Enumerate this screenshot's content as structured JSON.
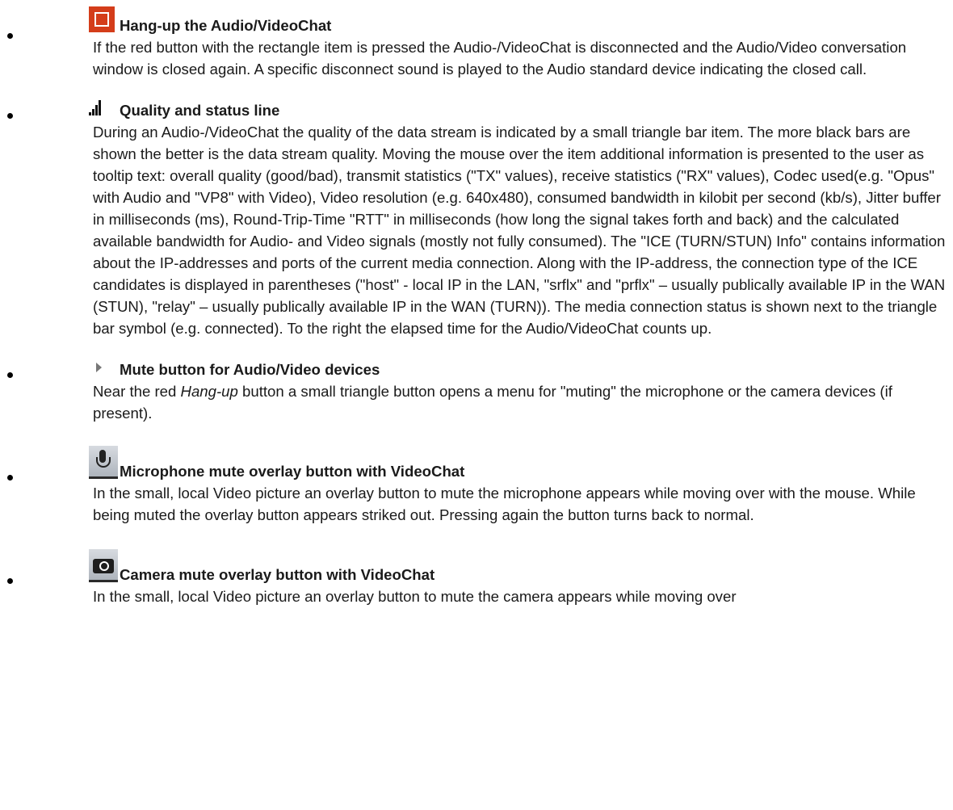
{
  "items": [
    {
      "icon": "hang-up-square-icon",
      "title": "Hang-up the Audio/VideoChat",
      "text": "If the red button with the rectangle item is pressed the Audio-/VideoChat is disconnected and the Audio/Video conversation window is closed again. A specific disconnect sound is played to the Audio standard device indicating the closed call."
    },
    {
      "icon": "signal-bars-icon",
      "title": "Quality and status line",
      "text": "During an Audio-/VideoChat the quality of the data stream is indicated by a small triangle bar item. The more black bars are shown the better is the data stream quality. Moving the mouse over the item additional information is presented to the user as tooltip text: overall quality (good/bad), transmit statistics (\"TX\" values), receive statistics (\"RX\" values), Codec used(e.g. \"Opus\" with Audio and \"VP8\" with Video), Video resolution (e.g. 640x480), consumed bandwidth in kilobit per second (kb/s), Jitter buffer in milliseconds (ms), Round-Trip-Time \"RTT\" in milliseconds (how long the signal takes forth and back) and the calculated available bandwidth for Audio- and Video signals (mostly not fully consumed). The \"ICE (TURN/STUN) Info\" contains information about the IP-addresses and ports of the current media connection. Along with the IP-address, the connection type of the ICE candidates is displayed in parentheses (\"host\" - local IP in the LAN, \"srflx\" and \"prflx\" – usually publically available IP in the WAN (STUN), \"relay\" – usually publically available IP in the WAN (TURN)). The media connection status is shown next to the triangle bar symbol (e.g. connected). To the right the elapsed time for the Audio/VideoChat counts up."
    },
    {
      "icon": "triangle-menu-icon",
      "title": "Mute button for Audio/Video devices",
      "text_before": "Near the red ",
      "text_em": "Hang-up",
      "text_after": " button a small triangle button opens a menu for \"muting\" the microphone or the camera devices (if present)."
    },
    {
      "icon": "microphone-icon",
      "title": "Microphone mute overlay button with VideoChat",
      "text": "In the small, local Video picture an overlay button to mute the microphone appears while moving over with the mouse. While being muted the overlay button appears striked out. Pressing again the button turns back to normal."
    },
    {
      "icon": "camera-icon",
      "title": "Camera mute overlay button with VideoChat",
      "text": "In the small, local Video picture an overlay button to mute the camera appears while moving over"
    }
  ]
}
